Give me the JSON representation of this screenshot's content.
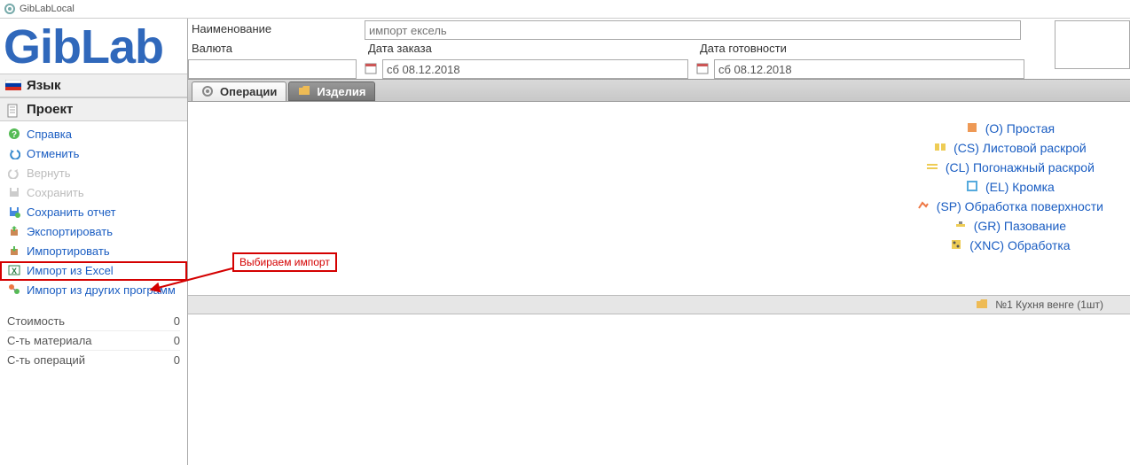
{
  "window": {
    "title": "GibLabLocal"
  },
  "logo": "GibLab",
  "sidebar": {
    "lang_header": "Язык",
    "project_header": "Проект",
    "actions": [
      {
        "label": "Справка",
        "icon": "help-icon",
        "disabled": false
      },
      {
        "label": "Отменить",
        "icon": "undo-icon",
        "disabled": false
      },
      {
        "label": "Вернуть",
        "icon": "redo-icon",
        "disabled": true
      },
      {
        "label": "Сохранить",
        "icon": "save-icon",
        "disabled": true
      },
      {
        "label": "Сохранить отчет",
        "icon": "report-icon",
        "disabled": false
      },
      {
        "label": "Экспортировать",
        "icon": "export-icon",
        "disabled": false
      },
      {
        "label": "Импортировать",
        "icon": "import-icon",
        "disabled": false
      },
      {
        "label": "Импорт из Excel",
        "icon": "excel-icon",
        "disabled": false
      },
      {
        "label": "Импорт из других программ",
        "icon": "import-other-icon",
        "disabled": false
      }
    ],
    "summary": [
      {
        "label": "Стоимость",
        "value": "0"
      },
      {
        "label": "С-ть материала",
        "value": "0"
      },
      {
        "label": "С-ть операций",
        "value": "0"
      }
    ]
  },
  "form": {
    "name_label": "Наименование",
    "name_placeholder": "импорт ексель",
    "currency_label": "Валюта",
    "currency_value": "",
    "order_date_label": "Дата заказа",
    "order_date_value": "сб 08.12.2018",
    "ready_date_label": "Дата готовности",
    "ready_date_value": "сб 08.12.2018"
  },
  "tabs": [
    {
      "label": "Операции",
      "icon": "gear-icon",
      "active": true
    },
    {
      "label": "Изделия",
      "icon": "folder-icon",
      "active": false
    }
  ],
  "operations": [
    {
      "label": "(O) Простая",
      "icon": "op-simple-icon"
    },
    {
      "label": "(CS) Листовой раскрой",
      "icon": "op-sheet-icon"
    },
    {
      "label": "(CL) Погонажный раскрой",
      "icon": "op-linear-icon"
    },
    {
      "label": "(EL) Кромка",
      "icon": "op-edge-icon"
    },
    {
      "label": "(SP) Обработка поверхности",
      "icon": "op-surface-icon"
    },
    {
      "label": "(GR) Пазование",
      "icon": "op-groove-icon"
    },
    {
      "label": "(XNC) Обработка",
      "icon": "op-xnc-icon"
    }
  ],
  "footer": {
    "item": "№1 Кухня венге (1шт)"
  },
  "annotation": {
    "label": "Выбираем импорт"
  }
}
